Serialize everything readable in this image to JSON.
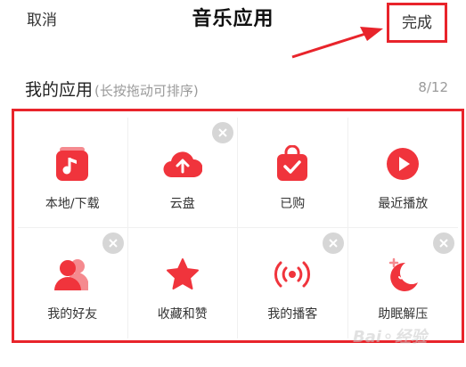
{
  "header": {
    "cancel_label": "取消",
    "title": "音乐应用",
    "done_label": "完成"
  },
  "section": {
    "title": "我的应用",
    "hint": "(长按拖动可排序)",
    "count": "8/12"
  },
  "apps": [
    {
      "label": "本地/下载",
      "icon": "music-note-icon",
      "removable": false
    },
    {
      "label": "云盘",
      "icon": "cloud-upload-icon",
      "removable": true
    },
    {
      "label": "已购",
      "icon": "shopping-bag-check-icon",
      "removable": false
    },
    {
      "label": "最近播放",
      "icon": "play-icon",
      "removable": false
    },
    {
      "label": "我的好友",
      "icon": "friends-icon",
      "removable": true
    },
    {
      "label": "收藏和赞",
      "icon": "star-icon",
      "removable": false
    },
    {
      "label": "我的播客",
      "icon": "podcast-icon",
      "removable": true
    },
    {
      "label": "助眠解压",
      "icon": "moon-icon",
      "removable": true
    }
  ],
  "colors": {
    "accent": "#e8242b",
    "icon_red": "#f0343c",
    "remove_badge": "#d6d6d6",
    "annotation": "#e8242b"
  },
  "watermark": "Bai⚬经验"
}
